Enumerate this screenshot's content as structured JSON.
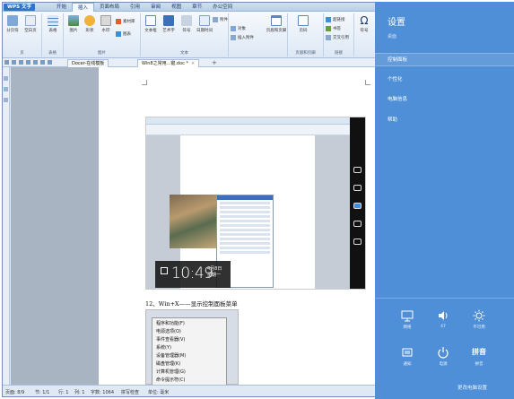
{
  "titlebar": {
    "app_button": "WPS 文字",
    "tabs": [
      "开始",
      "插入",
      "页面布局",
      "引用",
      "审阅",
      "视图",
      "章节",
      "办公空间"
    ],
    "active_tab": "插入"
  },
  "ribbon": {
    "buttons": [
      "分页符",
      "空白页",
      "表格",
      "图片",
      "形状",
      "水印",
      "文本框",
      "艺术字",
      "符号",
      "日期时间",
      "页眉和页脚",
      "页码",
      "对象",
      "符号",
      "公式"
    ],
    "mini": [
      "素材库",
      "图表",
      "附件",
      "插入附件",
      "超链接",
      "书签",
      "交叉引用"
    ],
    "groups": [
      "页",
      "表格",
      "图片",
      "文本",
      "页眉和页脚",
      "链接",
      "符号"
    ]
  },
  "tabbar": {
    "tabs": [
      {
        "label": "Docer-在线模板"
      },
      {
        "label": "Win8之常用...键.doc *"
      }
    ],
    "plus": "+"
  },
  "document": {
    "clock_time": "10:49",
    "clock_date": "4月8日",
    "clock_day": "星期一",
    "caption": "12、Win+X——显示控制面板菜单",
    "context_menu": [
      "程序和功能(F)",
      "电源选项(O)",
      "事件查看器(V)",
      "系统(Y)",
      "设备管理器(M)",
      "磁盘管理(K)",
      "计算机管理(G)",
      "命令提示符(C)"
    ]
  },
  "statusbar": {
    "page": "页面: 8/9",
    "section": "节: 1/1",
    "row": "行: 1",
    "col": "列: 1",
    "words": "字数: 1064",
    "spell": "拼写检查",
    "unit": "单位: 毫米"
  },
  "charm": {
    "title": "设置",
    "subtitle": "桌面",
    "items": [
      "控制面板",
      "个性化",
      "电脑信息",
      "帮助"
    ],
    "highlighted": "控制面板",
    "tiles": [
      {
        "icon": "network-icon",
        "label": "网络"
      },
      {
        "icon": "volume-icon",
        "label": "47"
      },
      {
        "icon": "brightness-icon",
        "label": "不可用"
      },
      {
        "icon": "notifications-icon",
        "label": "通知"
      },
      {
        "icon": "power-icon",
        "label": "电源"
      },
      {
        "icon": "keyboard-icon",
        "label": "拼音",
        "big": "拼音"
      }
    ],
    "footer": "更改电脑设置",
    "accent": "#4f8fd7"
  }
}
